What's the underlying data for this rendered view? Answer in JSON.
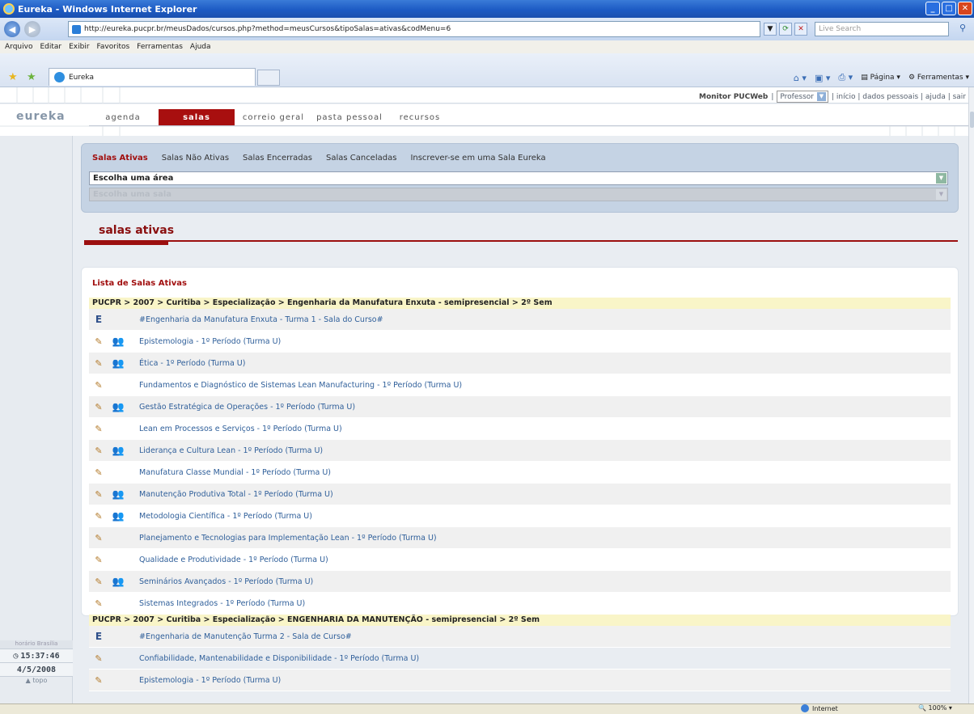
{
  "browser": {
    "window_title": "Eureka - Windows Internet Explorer",
    "url": "http://eureka.pucpr.br/meusDados/cursos.php?method=meusCursos&tipoSalas=ativas&codMenu=6",
    "search_placeholder": "Live Search",
    "menu": [
      "Arquivo",
      "Editar",
      "Exibir",
      "Favoritos",
      "Ferramentas",
      "Ajuda"
    ],
    "tab_label": "Eureka",
    "cmd": {
      "page": "Página",
      "tools": "Ferramentas"
    },
    "status_zone": "Internet",
    "zoom": "100%"
  },
  "site": {
    "logo": "eureka",
    "monitor": "Monitor PUCWeb",
    "role": "Professor",
    "toplinks": "| início | dados pessoais | ajuda | sair",
    "nav": [
      "agenda",
      "salas",
      "correio geral",
      "pasta pessoal",
      "recursos"
    ],
    "active_nav": "salas",
    "salas_links": [
      "Salas Ativas",
      "Salas Não Ativas",
      "Salas Encerradas",
      "Salas Canceladas",
      "Inscrever-se em uma Sala Eureka"
    ],
    "area_select": "Escolha uma área",
    "sala_select": "Escolha uma sala",
    "section_title": "salas ativas",
    "list_title": "Lista de Salas Ativas",
    "clock": {
      "label": "horário Brasília",
      "time": "15:37:46",
      "date": "4/5/2008",
      "top": "topo"
    }
  },
  "groups": [
    {
      "path": "PUCPR > 2007 > Curitiba > Especialização > Engenharia da Manufatura Enxuta - semipresencial > 2º Sem",
      "items": [
        {
          "icon": "E",
          "lock": false,
          "name": "#Engenharia da Manufatura Enxuta - Turma 1 - Sala do Curso#"
        },
        {
          "icon": "pencil",
          "lock": true,
          "name": "Epistemologia - 1º Período (Turma U)"
        },
        {
          "icon": "pencil",
          "lock": true,
          "name": "Ética - 1º Período (Turma U)"
        },
        {
          "icon": "pencil",
          "lock": false,
          "name": "Fundamentos e Diagnóstico de Sistemas Lean Manufacturing - 1º Período (Turma U)"
        },
        {
          "icon": "pencil",
          "lock": true,
          "name": "Gestão Estratégica de Operações - 1º Período (Turma U)"
        },
        {
          "icon": "pencil",
          "lock": false,
          "name": "Lean em Processos e Serviços - 1º Período (Turma U)"
        },
        {
          "icon": "pencil",
          "lock": true,
          "name": "Liderança e Cultura Lean - 1º Período (Turma U)"
        },
        {
          "icon": "pencil",
          "lock": false,
          "name": "Manufatura Classe Mundial - 1º Período (Turma U)"
        },
        {
          "icon": "pencil",
          "lock": true,
          "name": "Manutenção Produtiva Total - 1º Período (Turma U)"
        },
        {
          "icon": "pencil",
          "lock": true,
          "name": "Metodologia Científica - 1º Período (Turma U)"
        },
        {
          "icon": "pencil",
          "lock": false,
          "name": "Planejamento e Tecnologias para Implementação Lean - 1º Período (Turma U)"
        },
        {
          "icon": "pencil",
          "lock": false,
          "name": "Qualidade e Produtividade - 1º Período (Turma U)"
        },
        {
          "icon": "pencil",
          "lock": true,
          "name": "Seminários Avançados - 1º Período (Turma U)"
        },
        {
          "icon": "pencil",
          "lock": false,
          "name": "Sistemas Integrados - 1º Período (Turma U)"
        }
      ]
    },
    {
      "path": "PUCPR > 2007 > Curitiba > Especialização > ENGENHARIA DA MANUTENÇÃO - semipresencial > 2º Sem",
      "items": [
        {
          "icon": "E",
          "lock": false,
          "name": "#Engenharia de Manutenção Turma 2 - Sala de Curso#"
        },
        {
          "icon": "pencil",
          "lock": false,
          "name": "Confiabilidade, Mantenabilidade e Disponibilidade - 1º Período (Turma U)"
        },
        {
          "icon": "pencil",
          "lock": false,
          "name": "Epistemologia - 1º Período (Turma U)"
        }
      ]
    }
  ]
}
